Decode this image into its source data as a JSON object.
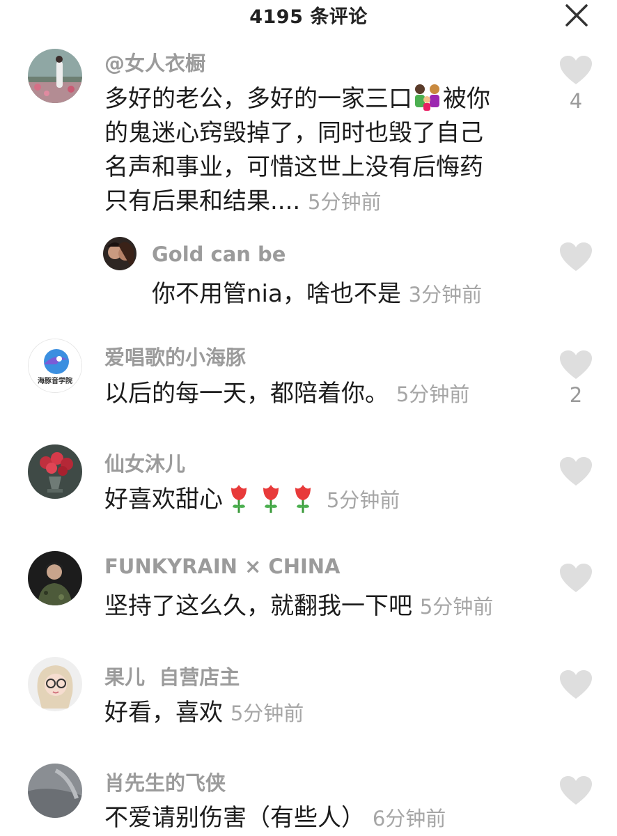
{
  "header": {
    "title": "4195 条评论",
    "close_icon": "close-icon"
  },
  "comments": [
    {
      "username": "@女人衣橱",
      "text_a": "多好的老公，多好的一家三口",
      "emoji_family": "family-emoji",
      "text_b": "被你\n的鬼迷心窍毁掉了，同时也毁了自己\n名声和事业，可惜这世上没有后悔药\n只有后果和结果.... ",
      "time": "5分钟前",
      "likes": "4"
    },
    {
      "username": "Gold can be",
      "text": "你不用管nia，啥也不是 ",
      "time": "3分钟前",
      "reply": true
    },
    {
      "username": "爱唱歌的小海豚",
      "avatar_text": "海豚音学院",
      "text": "以后的每一天，都陪着你。 ",
      "time": "5分钟前",
      "likes": "2"
    },
    {
      "username": "仙女沐儿",
      "text": "好喜欢甜心",
      "emoji": "rose-emoji",
      "time": "5分钟前"
    },
    {
      "username": "FUNKYRAIN × CHINA",
      "text": "坚持了这么久，就翻我一下吧 ",
      "time": "5分钟前"
    },
    {
      "username": "果儿  自营店主",
      "text": "好看，喜欢 ",
      "time": "5分钟前"
    },
    {
      "username": "肖先生的飞侠",
      "text": "不爱请别伤害（有些人）",
      "time": "6分钟前"
    }
  ],
  "colors": {
    "username": "#9b9b9b",
    "time": "#a6a6a6",
    "heart": "#dedede",
    "text": "#1c1c1c"
  }
}
